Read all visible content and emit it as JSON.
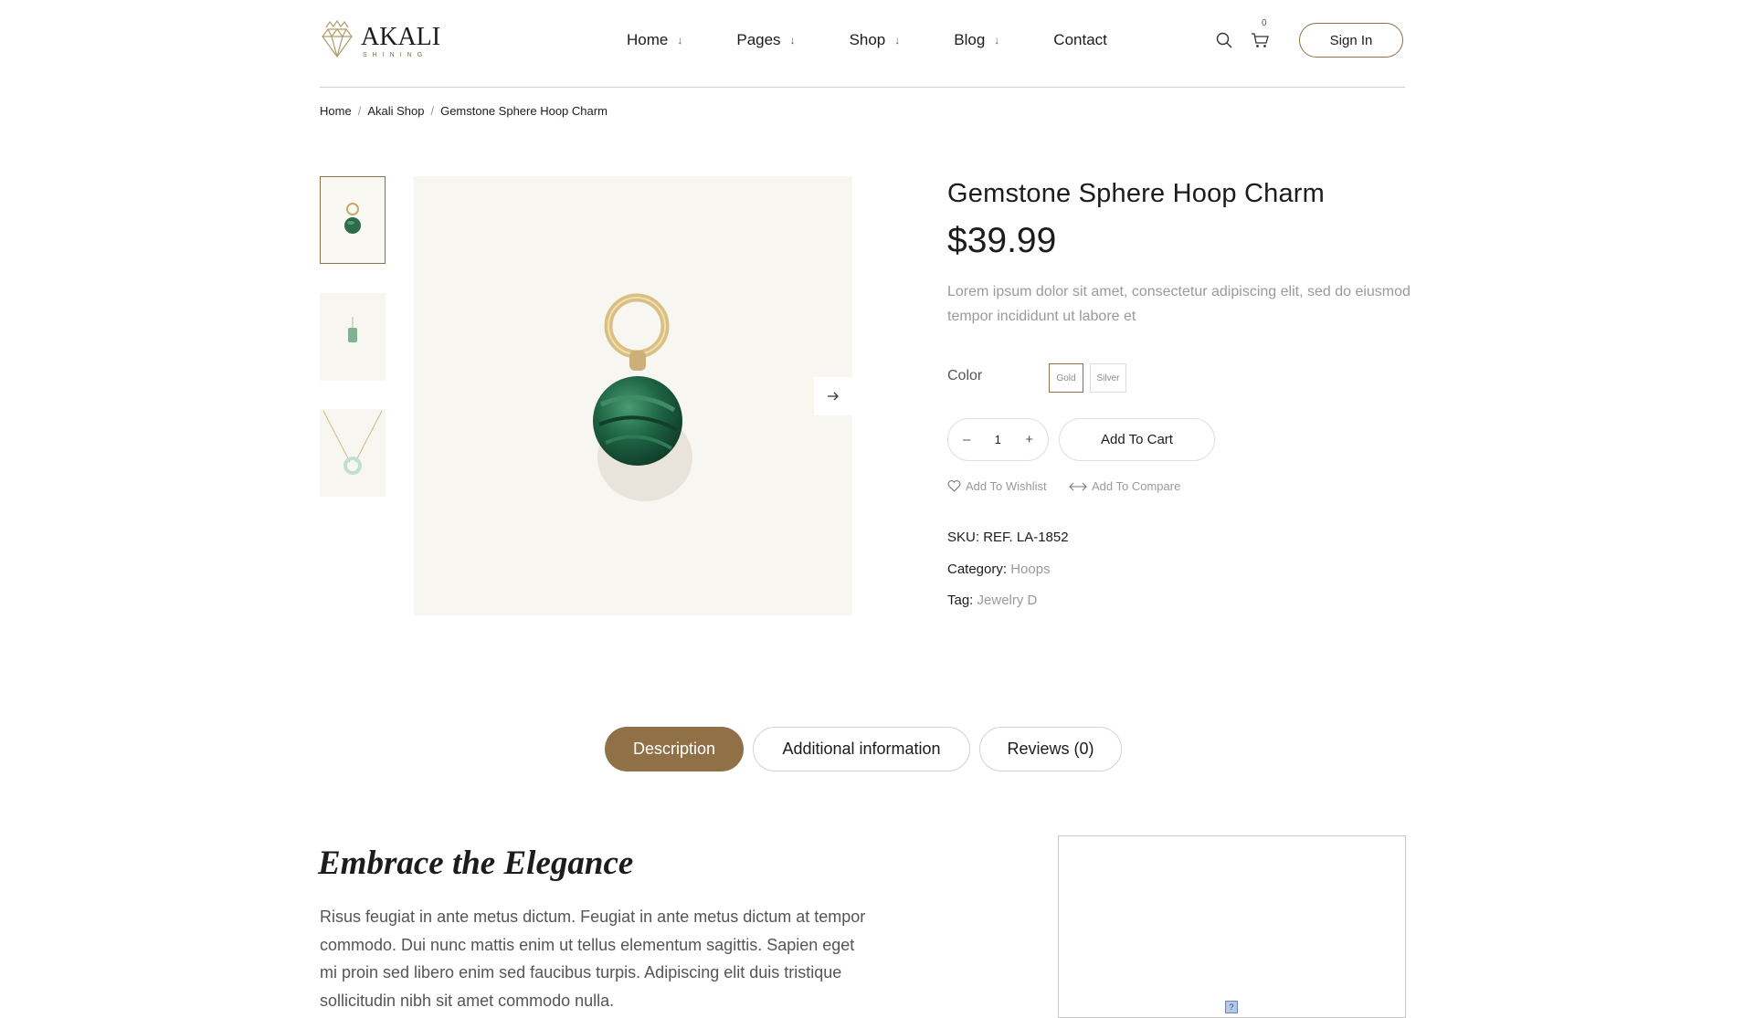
{
  "brand": {
    "name": "AKALI",
    "tagline": "SHINING",
    "accent": "#8f7047"
  },
  "nav": {
    "items": [
      {
        "label": "Home",
        "arrow": "↓"
      },
      {
        "label": "Pages",
        "arrow": "↓"
      },
      {
        "label": "Shop",
        "arrow": "↓"
      },
      {
        "label": "Blog",
        "arrow": "↓"
      },
      {
        "label": "Contact"
      }
    ]
  },
  "header": {
    "cart_count": "0",
    "sign_in": "Sign In"
  },
  "breadcrumb": {
    "home": "Home",
    "shop": "Akali Shop",
    "current": "Gemstone Sphere Hoop Charm",
    "separator": "/"
  },
  "product": {
    "title": "Gemstone Sphere Hoop Charm",
    "price": "$39.99",
    "description": "Lorem ipsum dolor sit amet, consectetur adipiscing elit, sed do eiusmod tempor incididunt ut labore et",
    "color_label": "Color",
    "color_options": [
      "Gold",
      "Silver"
    ],
    "selected_color": "Gold",
    "quantity": "1",
    "minus": "–",
    "plus": "+",
    "add_to_cart": "Add To Cart",
    "wishlist": "Add To Wishlist",
    "compare": "Add To Compare",
    "sku_label": "SKU:",
    "sku_value": "REF. LA-1852",
    "category_label": "Category:",
    "category_value": "Hoops",
    "tag_label": "Tag:",
    "tag_value": "Jewelry D"
  },
  "tabs": [
    {
      "label": "Description",
      "active": true
    },
    {
      "label": "Additional information",
      "active": false
    },
    {
      "label": "Reviews (0)",
      "active": false
    }
  ],
  "description_section": {
    "heading": "Embrace the Elegance",
    "body": "Risus feugiat in ante metus dictum. Feugiat in ante metus dictum at tempor commodo. Dui nunc mattis enim ut tellus elementum sagittis. Sapien eget mi proin sed libero enim sed faucibus turpis. Adipiscing elit duis tristique sollicitudin nibh sit amet commodo nulla.",
    "broken_image_glyph": "?"
  },
  "icons": {
    "search": "search-icon",
    "cart": "cart-icon",
    "next": "arrow-right-icon",
    "wishlist": "heart-icon",
    "compare": "compare-arrows-icon",
    "logo": "diamond-crown-icon"
  }
}
